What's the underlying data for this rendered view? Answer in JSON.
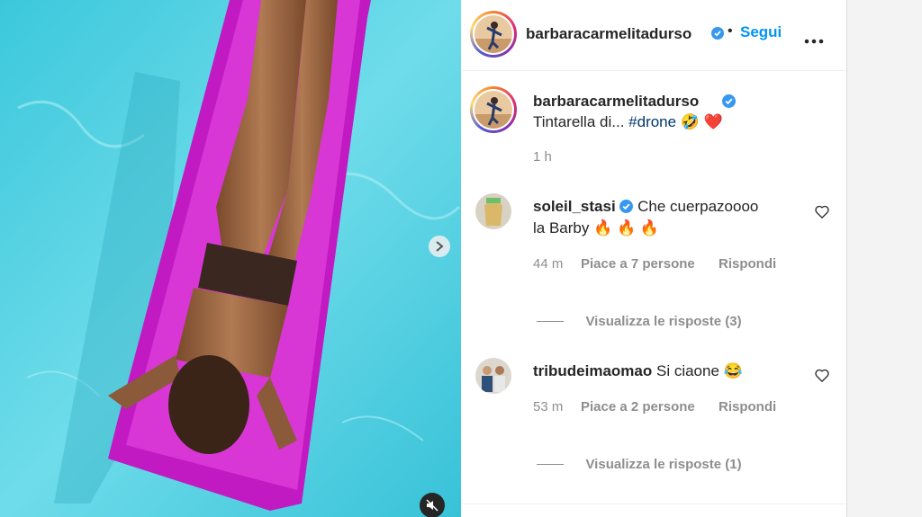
{
  "post": {
    "username": "barbaracarmelitadurso",
    "follow_label": "Segui",
    "dot": "•",
    "more_icon": "more-icon"
  },
  "caption": {
    "username": "barbaracarmelitadurso",
    "text_prefix": "Tintarella di...",
    "hashtag": "#drone",
    "emoji": "🤣 ❤️",
    "time": "1 h"
  },
  "comments": [
    {
      "username": "soleil_stasi",
      "text_line1": "Che cuerpazoooo",
      "text_line2": "la Barby",
      "emoji": "🔥 🔥 🔥",
      "time": "44 m",
      "likes": "Piace a 7 persone",
      "reply": "Rispondi",
      "view_replies": "Visualizza le risposte (3)"
    },
    {
      "username": "tribudeimaomao",
      "text_line1": "Si ciaone",
      "emoji": "😂",
      "time": "53 m",
      "likes": "Piace a 2 persone",
      "reply": "Rispondi",
      "view_replies": "Visualizza le risposte (1)"
    }
  ],
  "colors": {
    "accent": "#0095f6",
    "verified": "#3897f0",
    "hashtag": "#00376b"
  }
}
